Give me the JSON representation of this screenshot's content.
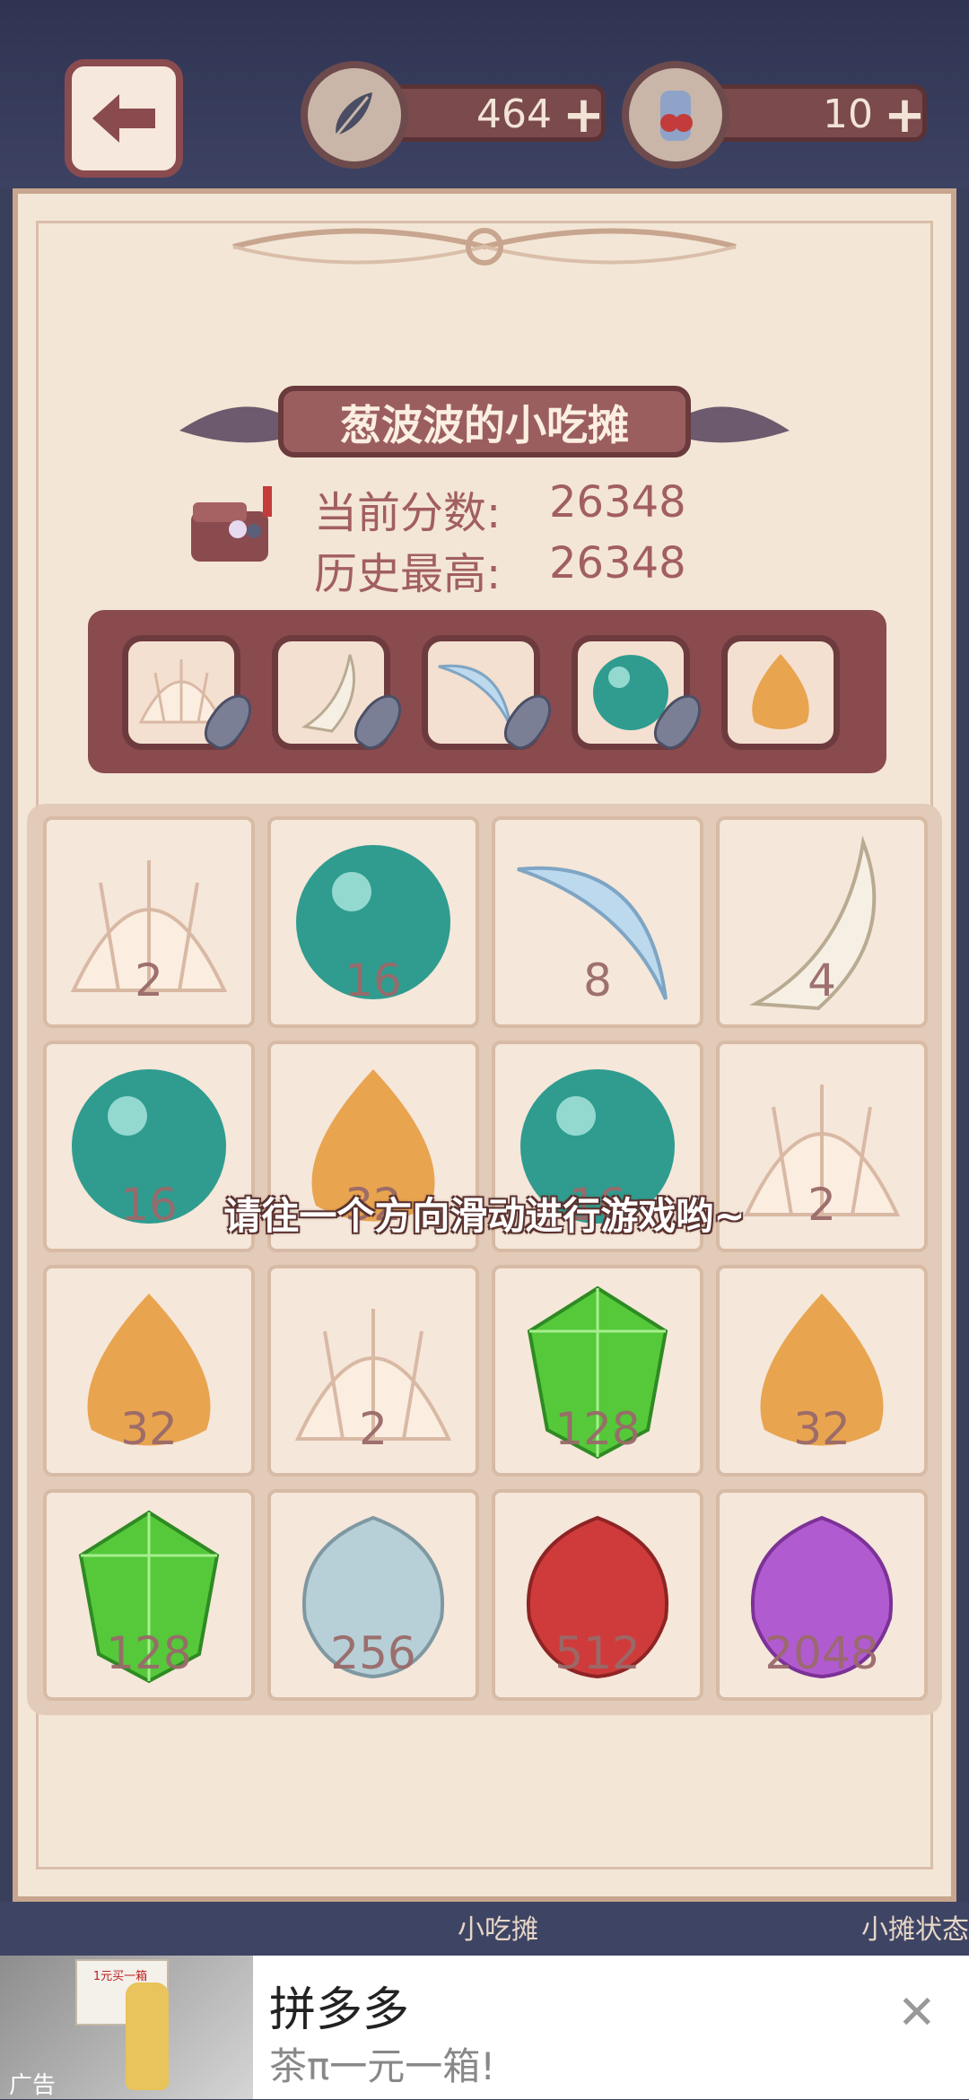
{
  "top": {
    "feathers": "464",
    "potion": "10",
    "plus": "+"
  },
  "title": "葱波波的小吃摊",
  "score": {
    "current_label": "当前分数:",
    "current_value": "26348",
    "best_label": "历史最高:",
    "best_value": "26348"
  },
  "tray_icons": [
    "shell-icon",
    "tooth-icon",
    "claw-icon",
    "teal-orb-icon",
    "amber-drop-icon"
  ],
  "grid": [
    [
      {
        "icon": "shell",
        "value": "2"
      },
      {
        "icon": "teal-orb",
        "value": "16"
      },
      {
        "icon": "claw",
        "value": "8"
      },
      {
        "icon": "tooth",
        "value": "4"
      }
    ],
    [
      {
        "icon": "teal-orb",
        "value": "16"
      },
      {
        "icon": "amber-drop",
        "value": "32"
      },
      {
        "icon": "teal-orb",
        "value": "16"
      },
      {
        "icon": "shell",
        "value": "2"
      }
    ],
    [
      {
        "icon": "amber-drop",
        "value": "32"
      },
      {
        "icon": "shell",
        "value": "2"
      },
      {
        "icon": "green-gem",
        "value": "128"
      },
      {
        "icon": "amber-drop",
        "value": "32"
      }
    ],
    [
      {
        "icon": "green-gem",
        "value": "128"
      },
      {
        "icon": "silver-bud",
        "value": "256"
      },
      {
        "icon": "red-bud",
        "value": "512"
      },
      {
        "icon": "purple-bud",
        "value": "2048"
      }
    ]
  ],
  "hint": "请往一个方向滑动进行游戏哟~",
  "bottom_tabs": {
    "snack": "小吃摊",
    "right": "小摊状态"
  },
  "ad": {
    "tag": "广告",
    "title": "拼多多",
    "subtitle": "茶π一元一箱!",
    "close": "✕",
    "box_text": "1元买一箱"
  },
  "colors": {
    "accent": "#8a4b4f",
    "panel": "#f3e6d6",
    "teal": "#2f9c8f",
    "amber": "#e8a44f",
    "green": "#55c93a"
  }
}
